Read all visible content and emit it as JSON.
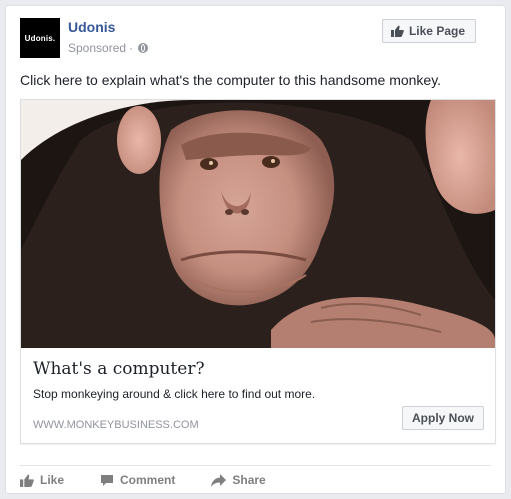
{
  "post": {
    "page_name": "Udonis",
    "avatar_text": "Udonis.",
    "sponsored": "Sponsored",
    "separator": "·",
    "like_page_label": "Like Page",
    "text": "Click here to explain what's the computer to this handsome monkey."
  },
  "ad": {
    "image_icon": "chimpanzee-photo",
    "headline": "What's a computer?",
    "description": "Stop monkeying around & click here to find out more.",
    "domain": "WWW.MONKEYBUSINESS.COM",
    "cta_label": "Apply Now"
  },
  "actions": [
    {
      "label": "Like",
      "icon": "thumbs-up-icon"
    },
    {
      "label": "Comment",
      "icon": "comment-icon"
    },
    {
      "label": "Share",
      "icon": "share-icon"
    }
  ],
  "colors": {
    "link_blue": "#365899",
    "meta_gray": "#90949c",
    "action_gray": "#7f7f7f"
  }
}
